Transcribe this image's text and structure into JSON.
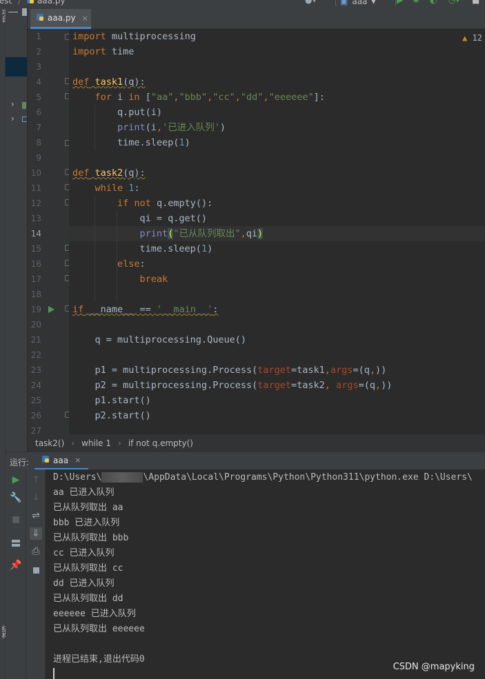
{
  "topbar": {
    "project_crumb": "test",
    "file_crumb": "aaa.py",
    "run_config": "aaa"
  },
  "left_strip": {
    "top_label": "项目",
    "bottom_label": "结构"
  },
  "project_tree": {
    "rows": [
      "›",
      "›"
    ]
  },
  "editor_tab": {
    "label": "aaa.py",
    "close": "×"
  },
  "inspection": {
    "count": "12"
  },
  "code_lines": [
    "import multiprocessing",
    "import time",
    "",
    "def task1(q):",
    "    for i in [\"aa\",\"bbb\",\"cc\",\"dd\",\"eeeeee\"]:",
    "        q.put(i)",
    "        print(i,'已进入队列')",
    "        time.sleep(1)",
    "",
    "def task2(q):",
    "    while 1:",
    "        if not q.empty():",
    "            qi = q.get()",
    "            print(\"已从队列取出\",qi)",
    "            time.sleep(1)",
    "        else:",
    "            break",
    "",
    "if __name__ == '__main__':",
    "",
    "    q = multiprocessing.Queue()",
    "",
    "    p1 = multiprocessing.Process(target=task1,args=(q,))",
    "    p2 = multiprocessing.Process(target=task2, args=(q,))",
    "    p1.start()",
    "    p2.start()",
    ""
  ],
  "line_numbers": [
    "1",
    "2",
    "3",
    "4",
    "5",
    "6",
    "7",
    "8",
    "9",
    "10",
    "11",
    "12",
    "13",
    "14",
    "15",
    "16",
    "17",
    "18",
    "19",
    "20",
    "21",
    "22",
    "23",
    "24",
    "25",
    "26",
    "27"
  ],
  "current_line": 14,
  "breadcrumb": [
    "task2()",
    "while 1",
    "if not q.empty()"
  ],
  "run_panel": {
    "label": "运行:",
    "tab": "aaa",
    "console_first_prefix": "D:\\Users\\",
    "console_first_suffix": "\\AppData\\Local\\Programs\\Python\\Python311\\python.exe D:\\Users\\",
    "console_lines": [
      "aa 已进入队列",
      "已从队列取出 aa",
      "bbb 已进入队列",
      "已从队列取出 bbb",
      "cc 已进入队列",
      "已从队列取出 cc",
      "dd 已进入队列",
      "已从队列取出 dd",
      "eeeeee 已进入队列",
      "已从队列取出 eeeeee",
      "",
      "进程已结束,退出代码0"
    ]
  },
  "watermark": "CSDN @mapyking",
  "colors": {
    "keyword": "#cc7832",
    "function": "#ffc66d",
    "string": "#6a8759",
    "number": "#6897bb",
    "builtin": "#8888c6",
    "param": "#aa4926",
    "run_green": "#499c54",
    "accent": "#4a88c7"
  },
  "icons": [
    "python-file-icon",
    "run-icon",
    "debug-icon",
    "profile-icon",
    "stop-icon",
    "wrench-icon",
    "wrap-icon",
    "print-icon",
    "trash-icon",
    "pin-icon",
    "warning-icon"
  ]
}
